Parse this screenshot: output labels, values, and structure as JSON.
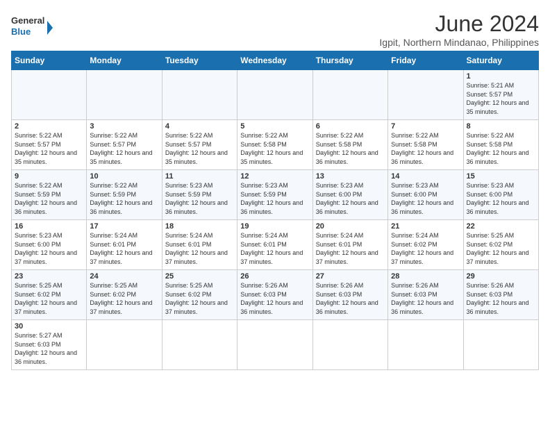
{
  "logo": {
    "line1": "General",
    "line2": "Blue"
  },
  "title": "June 2024",
  "subtitle": "Igpit, Northern Mindanao, Philippines",
  "days_of_week": [
    "Sunday",
    "Monday",
    "Tuesday",
    "Wednesday",
    "Thursday",
    "Friday",
    "Saturday"
  ],
  "weeks": [
    {
      "days": [
        {
          "num": "",
          "info": ""
        },
        {
          "num": "",
          "info": ""
        },
        {
          "num": "",
          "info": ""
        },
        {
          "num": "",
          "info": ""
        },
        {
          "num": "",
          "info": ""
        },
        {
          "num": "",
          "info": ""
        },
        {
          "num": "1",
          "info": "Sunrise: 5:21 AM\nSunset: 5:57 PM\nDaylight: 12 hours and 35 minutes."
        }
      ]
    },
    {
      "days": [
        {
          "num": "2",
          "info": "Sunrise: 5:22 AM\nSunset: 5:57 PM\nDaylight: 12 hours and 35 minutes."
        },
        {
          "num": "3",
          "info": "Sunrise: 5:22 AM\nSunset: 5:57 PM\nDaylight: 12 hours and 35 minutes."
        },
        {
          "num": "4",
          "info": "Sunrise: 5:22 AM\nSunset: 5:57 PM\nDaylight: 12 hours and 35 minutes."
        },
        {
          "num": "5",
          "info": "Sunrise: 5:22 AM\nSunset: 5:58 PM\nDaylight: 12 hours and 35 minutes."
        },
        {
          "num": "6",
          "info": "Sunrise: 5:22 AM\nSunset: 5:58 PM\nDaylight: 12 hours and 36 minutes."
        },
        {
          "num": "7",
          "info": "Sunrise: 5:22 AM\nSunset: 5:58 PM\nDaylight: 12 hours and 36 minutes."
        },
        {
          "num": "8",
          "info": "Sunrise: 5:22 AM\nSunset: 5:58 PM\nDaylight: 12 hours and 36 minutes."
        }
      ]
    },
    {
      "days": [
        {
          "num": "9",
          "info": "Sunrise: 5:22 AM\nSunset: 5:59 PM\nDaylight: 12 hours and 36 minutes."
        },
        {
          "num": "10",
          "info": "Sunrise: 5:22 AM\nSunset: 5:59 PM\nDaylight: 12 hours and 36 minutes."
        },
        {
          "num": "11",
          "info": "Sunrise: 5:23 AM\nSunset: 5:59 PM\nDaylight: 12 hours and 36 minutes."
        },
        {
          "num": "12",
          "info": "Sunrise: 5:23 AM\nSunset: 5:59 PM\nDaylight: 12 hours and 36 minutes."
        },
        {
          "num": "13",
          "info": "Sunrise: 5:23 AM\nSunset: 6:00 PM\nDaylight: 12 hours and 36 minutes."
        },
        {
          "num": "14",
          "info": "Sunrise: 5:23 AM\nSunset: 6:00 PM\nDaylight: 12 hours and 36 minutes."
        },
        {
          "num": "15",
          "info": "Sunrise: 5:23 AM\nSunset: 6:00 PM\nDaylight: 12 hours and 36 minutes."
        }
      ]
    },
    {
      "days": [
        {
          "num": "16",
          "info": "Sunrise: 5:23 AM\nSunset: 6:00 PM\nDaylight: 12 hours and 37 minutes."
        },
        {
          "num": "17",
          "info": "Sunrise: 5:24 AM\nSunset: 6:01 PM\nDaylight: 12 hours and 37 minutes."
        },
        {
          "num": "18",
          "info": "Sunrise: 5:24 AM\nSunset: 6:01 PM\nDaylight: 12 hours and 37 minutes."
        },
        {
          "num": "19",
          "info": "Sunrise: 5:24 AM\nSunset: 6:01 PM\nDaylight: 12 hours and 37 minutes."
        },
        {
          "num": "20",
          "info": "Sunrise: 5:24 AM\nSunset: 6:01 PM\nDaylight: 12 hours and 37 minutes."
        },
        {
          "num": "21",
          "info": "Sunrise: 5:24 AM\nSunset: 6:02 PM\nDaylight: 12 hours and 37 minutes."
        },
        {
          "num": "22",
          "info": "Sunrise: 5:25 AM\nSunset: 6:02 PM\nDaylight: 12 hours and 37 minutes."
        }
      ]
    },
    {
      "days": [
        {
          "num": "23",
          "info": "Sunrise: 5:25 AM\nSunset: 6:02 PM\nDaylight: 12 hours and 37 minutes."
        },
        {
          "num": "24",
          "info": "Sunrise: 5:25 AM\nSunset: 6:02 PM\nDaylight: 12 hours and 37 minutes."
        },
        {
          "num": "25",
          "info": "Sunrise: 5:25 AM\nSunset: 6:02 PM\nDaylight: 12 hours and 37 minutes."
        },
        {
          "num": "26",
          "info": "Sunrise: 5:26 AM\nSunset: 6:03 PM\nDaylight: 12 hours and 36 minutes."
        },
        {
          "num": "27",
          "info": "Sunrise: 5:26 AM\nSunset: 6:03 PM\nDaylight: 12 hours and 36 minutes."
        },
        {
          "num": "28",
          "info": "Sunrise: 5:26 AM\nSunset: 6:03 PM\nDaylight: 12 hours and 36 minutes."
        },
        {
          "num": "29",
          "info": "Sunrise: 5:26 AM\nSunset: 6:03 PM\nDaylight: 12 hours and 36 minutes."
        }
      ]
    },
    {
      "days": [
        {
          "num": "30",
          "info": "Sunrise: 5:27 AM\nSunset: 6:03 PM\nDaylight: 12 hours and 36 minutes."
        },
        {
          "num": "",
          "info": ""
        },
        {
          "num": "",
          "info": ""
        },
        {
          "num": "",
          "info": ""
        },
        {
          "num": "",
          "info": ""
        },
        {
          "num": "",
          "info": ""
        },
        {
          "num": "",
          "info": ""
        }
      ]
    }
  ]
}
